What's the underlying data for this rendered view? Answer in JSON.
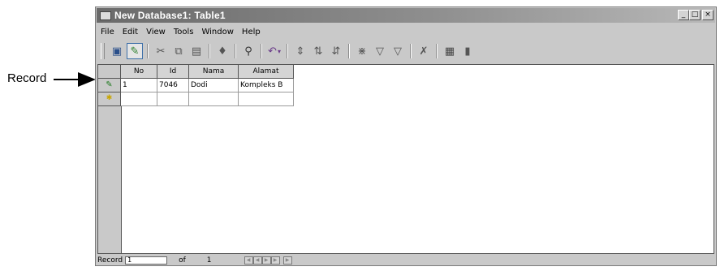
{
  "callout": {
    "label": "Record"
  },
  "window": {
    "title": "New Database1: Table1",
    "controls": {
      "minimize": "_",
      "maximize": "□",
      "close": "×"
    }
  },
  "menu": [
    "File",
    "Edit",
    "View",
    "Tools",
    "Window",
    "Help"
  ],
  "toolbar": {
    "icons": [
      "save-icon",
      "edit-record-icon",
      "cut-icon",
      "copy-icon",
      "paste-icon",
      "format-painter-icon",
      "find-icon",
      "undo-icon",
      "insert-column-icon",
      "sort-ascending-icon",
      "sort-descending-icon",
      "filter-by-selection-icon",
      "filter-by-form-icon",
      "apply-filter-icon",
      "delete-record-icon",
      "database-window-icon"
    ]
  },
  "table": {
    "columns": [
      "No",
      "Id",
      "Nama",
      "Alamat"
    ],
    "rows": [
      {
        "No": "1",
        "Id": "7046",
        "Nama": "Dodi",
        "Alamat": "Kompleks B"
      }
    ]
  },
  "navigation": {
    "label": "Record",
    "current": "1",
    "of_label": "of",
    "total": "1"
  },
  "colors": {
    "title_bar": "#6a6a6a",
    "chrome": "#c9c9c9",
    "new_record_marker": "#c9a600",
    "edit_marker": "#1d7a1d"
  }
}
